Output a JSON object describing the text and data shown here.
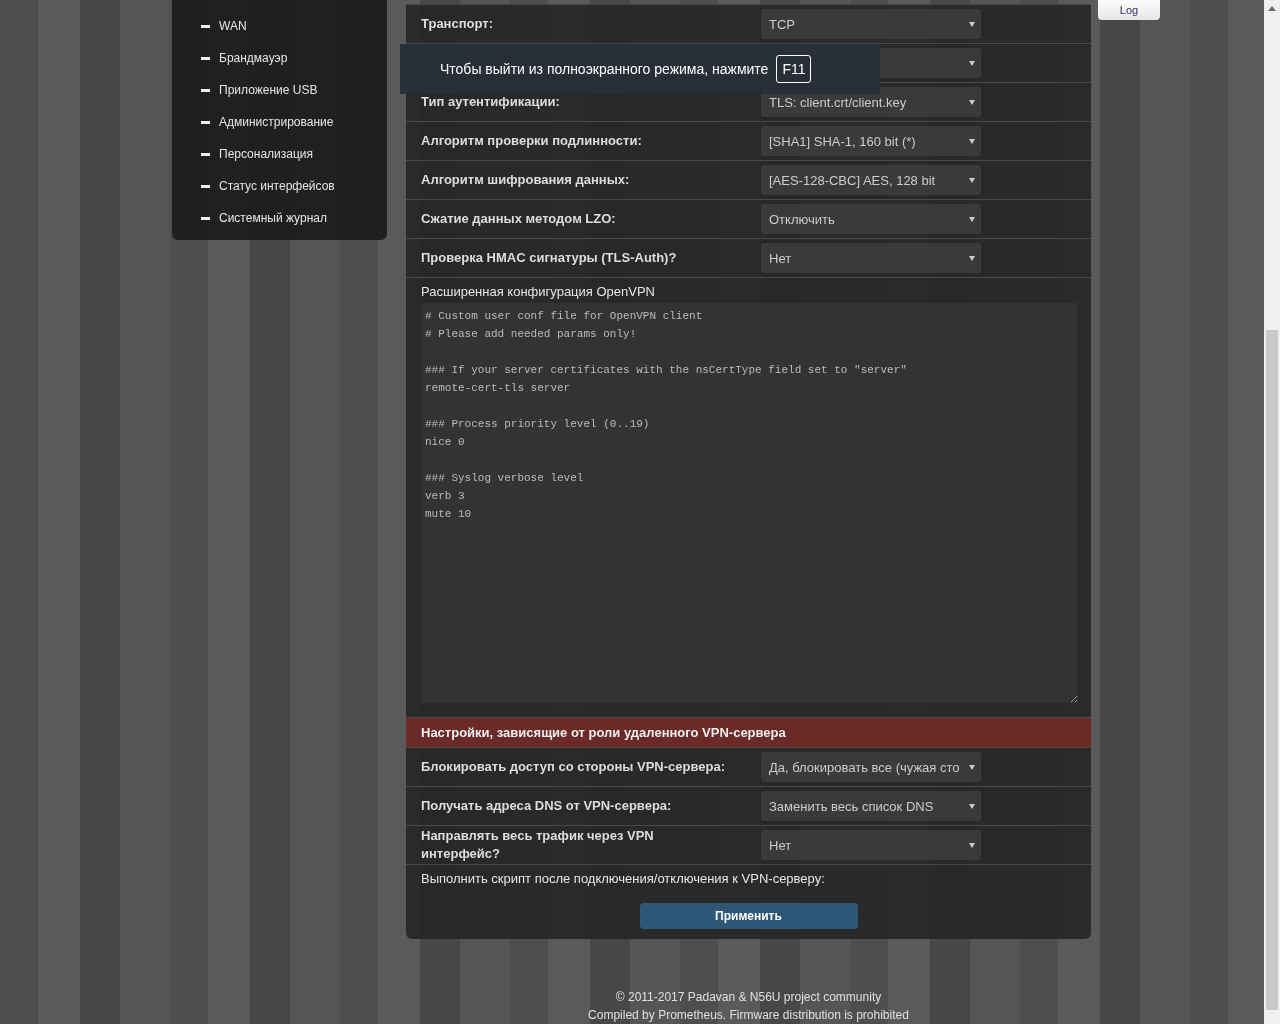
{
  "sidebar": {
    "items": [
      {
        "label": "WAN"
      },
      {
        "label": "Брандмауэр"
      },
      {
        "label": "Приложение USB"
      },
      {
        "label": "Администрирование"
      },
      {
        "label": "Персонализация"
      },
      {
        "label": "Статус интерфейсов"
      },
      {
        "label": "Системный журнал"
      }
    ]
  },
  "log_button": "Log",
  "fullscreen_notice": {
    "text": "Чтобы выйти из полноэкранного режима, нажмите",
    "key": "F11"
  },
  "settings": {
    "rows": [
      {
        "kind": "select",
        "label": "Транспорт:",
        "value": "TCP"
      },
      {
        "kind": "select"
      },
      {
        "kind": "select",
        "label": "Тип аутентификации:",
        "value": "TLS: client.crt/client.key"
      },
      {
        "kind": "select",
        "label": "Алгоритм проверки подлинности:",
        "value": "[SHA1] SHA-1, 160 bit (*)"
      },
      {
        "kind": "select",
        "label": "Алгоритм шифрования данных:",
        "value": "[AES-128-CBC] AES, 128 bit"
      },
      {
        "kind": "select",
        "label": "Сжатие данных методом LZO:",
        "value": "Отключить"
      },
      {
        "kind": "select",
        "label": "Проверка HMAC сигнатуры (TLS-Auth)?",
        "value": "Нет"
      },
      {
        "kind": "textarea",
        "label": "Расширенная конфигурация OpenVPN",
        "value": "# Custom user conf file for OpenVPN client\n# Please add needed params only!\n\n### If your server certificates with the nsCertType field set to \"server\"\nremote-cert-tls server\n\n### Process priority level (0..19)\nnice 0\n\n### Syslog verbose level\nverb 3\nmute 10"
      }
    ]
  },
  "role_section": {
    "title": "Настройки, зависящие от роли удаленного VPN-сервера",
    "rows": [
      {
        "kind": "select",
        "label": "Блокировать доступ со стороны VPN-сервера:",
        "value": "Да, блокировать все (чужая сто"
      },
      {
        "kind": "select",
        "label": "Получать адреса DNS от VPN-сервера:",
        "value": "Заменить весь список DNS"
      },
      {
        "kind": "select",
        "label": "Направлять весь трафик через VPN интерфейс?",
        "value": "Нет"
      },
      {
        "kind": "note",
        "label": "Выполнить скрипт после подключения/отключения к VPN-серверу:"
      }
    ]
  },
  "apply_button": "Применить",
  "footer": [
    "© 2011-2017 Padavan & N56U project community",
    "Compiled by Prometheus. Firmware distribution is prohibited"
  ]
}
